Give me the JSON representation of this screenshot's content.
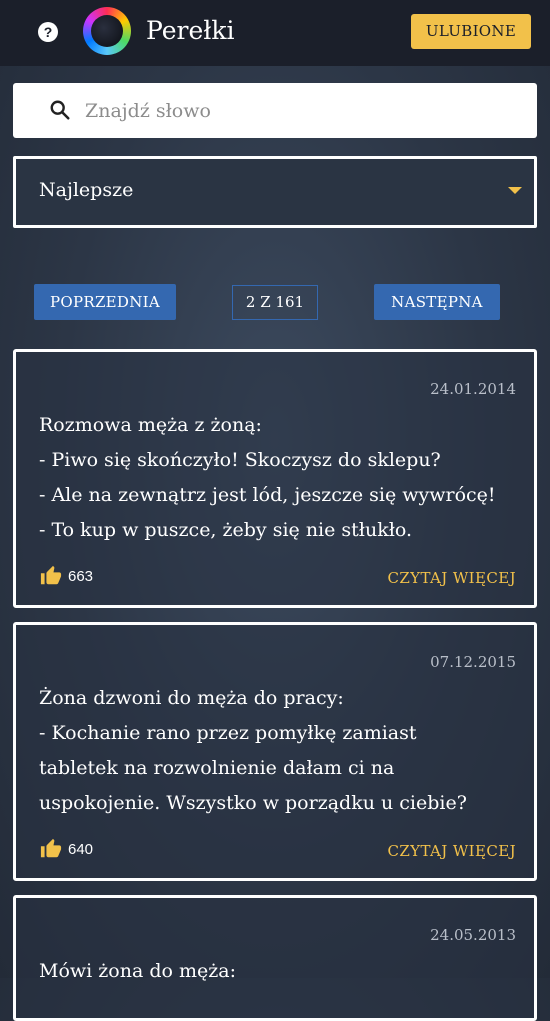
{
  "header": {
    "help_label": "?",
    "app_title": "Perełki",
    "favorites_label": "ULUBIONE"
  },
  "search": {
    "placeholder": "Znajdź słowo",
    "icon": "search-icon"
  },
  "sort": {
    "selected": "Najlepsze"
  },
  "pagination": {
    "prev_label": "POPRZEDNIA",
    "page_info": "2 Z 161",
    "next_label": "NASTĘPNA"
  },
  "cards": [
    {
      "date": "24.01.2014",
      "lines": [
        "Rozmowa męża z żoną:",
        "- Piwo się skończyło! Skoczysz do sklepu?",
        "- Ale na zewnątrz jest lód, jeszcze się wywrócę!",
        "- To kup w puszce, żeby się nie stłukło."
      ],
      "likes": "663",
      "read_more": "CZYTAJ WIĘCEJ"
    },
    {
      "date": "07.12.2015",
      "lines": [
        "Żona dzwoni do męża do pracy:",
        "- Kochanie rano przez pomyłkę zamiast",
        "tabletek na rozwolnienie dałam ci na",
        "uspokojenie. Wszystko w porządku u ciebie?"
      ],
      "likes": "640",
      "read_more": "CZYTAJ WIĘCEJ"
    },
    {
      "date": "24.05.2013",
      "lines": [
        "Mówi żona do męża:"
      ]
    }
  ],
  "colors": {
    "header_bg": "#1b1f2a",
    "accent_yellow": "#f2c14a",
    "button_blue": "#3468b0"
  }
}
